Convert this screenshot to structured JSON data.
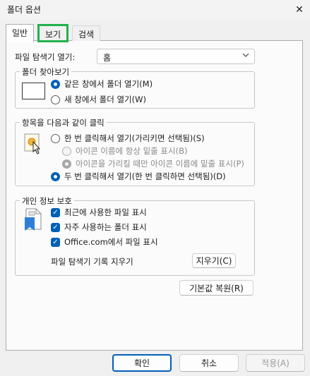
{
  "window": {
    "title": "폴더 옵션",
    "close_glyph": "✕"
  },
  "tabs": [
    {
      "label": "일반",
      "active": true
    },
    {
      "label": "보기",
      "active": false
    },
    {
      "label": "검색",
      "active": false
    }
  ],
  "explorer_open": {
    "label": "파일 탐색기 열기:",
    "value": "홈"
  },
  "browse_folders": {
    "legend": "폴더 찾아보기",
    "options": [
      {
        "label": "같은 창에서 폴더 열기(M)",
        "selected": true
      },
      {
        "label": "새 창에서 폴더 열기(W)",
        "selected": false
      }
    ]
  },
  "click_items": {
    "legend": "항목을 다음과 같이 클릭",
    "single_click": {
      "label": "한 번 클릭해서 열기(가리키면 선택됨)(S)",
      "selected": false
    },
    "underline_always": {
      "label": "아이콘 이름에 항상 밑줄 표시(B)",
      "selected": false
    },
    "underline_hover": {
      "label": "아이콘을 가리킬 때만 아이콘 이름에 밑줄 표시(P)",
      "selected": true
    },
    "double_click": {
      "label": "두 번 클릭해서 열기(한 번 클릭하면 선택됨)(D)",
      "selected": true
    }
  },
  "privacy": {
    "legend": "개인 정보 보호",
    "checks": [
      {
        "label": "최근에 사용한 파일 표시",
        "checked": true
      },
      {
        "label": "자주 사용하는 폴더 표시",
        "checked": true
      },
      {
        "label": "Office.com에서 파일 표시",
        "checked": true
      }
    ],
    "clear_history_label": "파일 탐색기 기록 지우기",
    "clear_button": "지우기(C)"
  },
  "restore_defaults_button": "기본값 복원(R)",
  "footer": {
    "ok": "확인",
    "cancel": "취소",
    "apply": "적용(A)"
  },
  "colors": {
    "accent": "#005fb8",
    "highlight_outline": "#22b14c"
  }
}
